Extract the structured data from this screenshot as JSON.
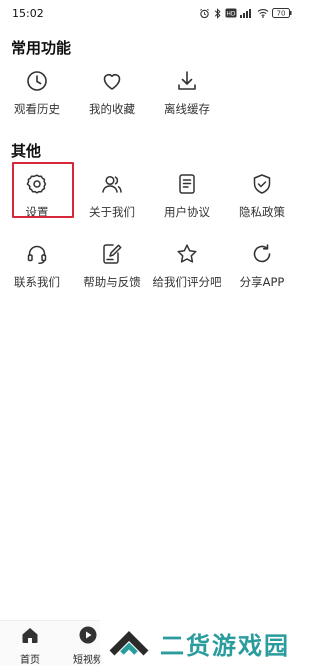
{
  "status_bar": {
    "time": "15:02",
    "battery": "70"
  },
  "sections": [
    {
      "title": "常用功能",
      "items": [
        {
          "label": "观看历史",
          "icon": "clock-icon"
        },
        {
          "label": "我的收藏",
          "icon": "heart-icon"
        },
        {
          "label": "离线缓存",
          "icon": "download-icon"
        }
      ]
    },
    {
      "title": "其他",
      "items": [
        {
          "label": "设置",
          "icon": "gear-icon"
        },
        {
          "label": "关于我们",
          "icon": "users-icon"
        },
        {
          "label": "用户协议",
          "icon": "document-icon"
        },
        {
          "label": "隐私政策",
          "icon": "shield-icon"
        },
        {
          "label": "联系我们",
          "icon": "headset-icon"
        },
        {
          "label": "帮助与反馈",
          "icon": "edit-note-icon"
        },
        {
          "label": "给我们评分吧",
          "icon": "star-icon"
        },
        {
          "label": "分享APP",
          "icon": "refresh-share-icon"
        }
      ]
    }
  ],
  "bottom_nav": {
    "items": [
      {
        "label": "首页",
        "icon": "home-icon"
      },
      {
        "label": "短视频",
        "icon": "play-icon"
      }
    ]
  },
  "watermark": {
    "text": "二货游戏园"
  },
  "colors": {
    "highlight": "#d8263a",
    "watermark": "#2a9c9e",
    "icon_stroke": "#333333"
  }
}
